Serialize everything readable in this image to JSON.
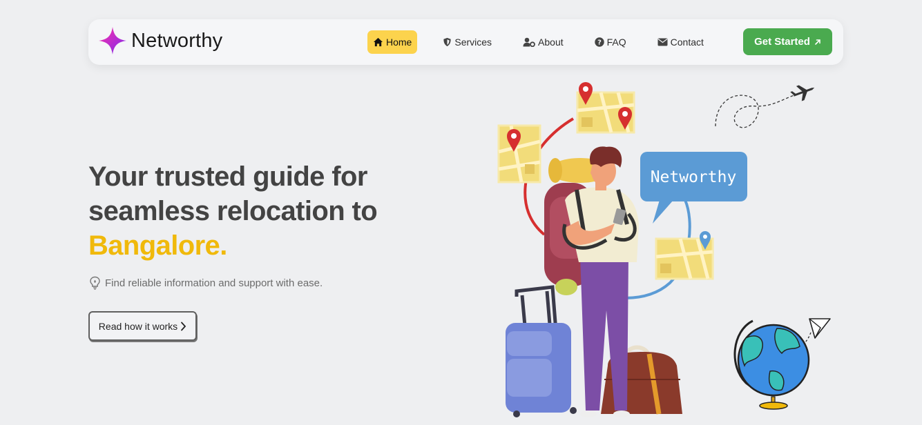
{
  "brand": {
    "name": "Networthy"
  },
  "nav": {
    "items": [
      {
        "label": "Home",
        "icon": "home-icon",
        "active": true
      },
      {
        "label": "Services",
        "icon": "shield-icon",
        "active": false
      },
      {
        "label": "About",
        "icon": "user-gear-icon",
        "active": false
      },
      {
        "label": "FAQ",
        "icon": "question-circle-icon",
        "active": false
      },
      {
        "label": "Contact",
        "icon": "envelope-icon",
        "active": false
      }
    ],
    "cta_label": "Get Started",
    "cta_icon": "arrow-up-right-icon"
  },
  "hero": {
    "title_line1": "Your trusted guide for",
    "title_line2": "seamless relocation to",
    "title_accent": "Bangalore.",
    "subtitle": "Find reliable information and support with ease.",
    "subtitle_icon": "lightbulb-icon",
    "read_button_label": "Read how it works",
    "read_button_icon": "chevron-right-icon"
  },
  "illustration": {
    "speech_bubble_text": "Networthy"
  },
  "colors": {
    "background": "#eeeff1",
    "accent_yellow": "#f0b90b",
    "active_nav": "#fcd34d",
    "cta_green": "#4aaa4f",
    "bubble_blue": "#5b9bd5"
  }
}
